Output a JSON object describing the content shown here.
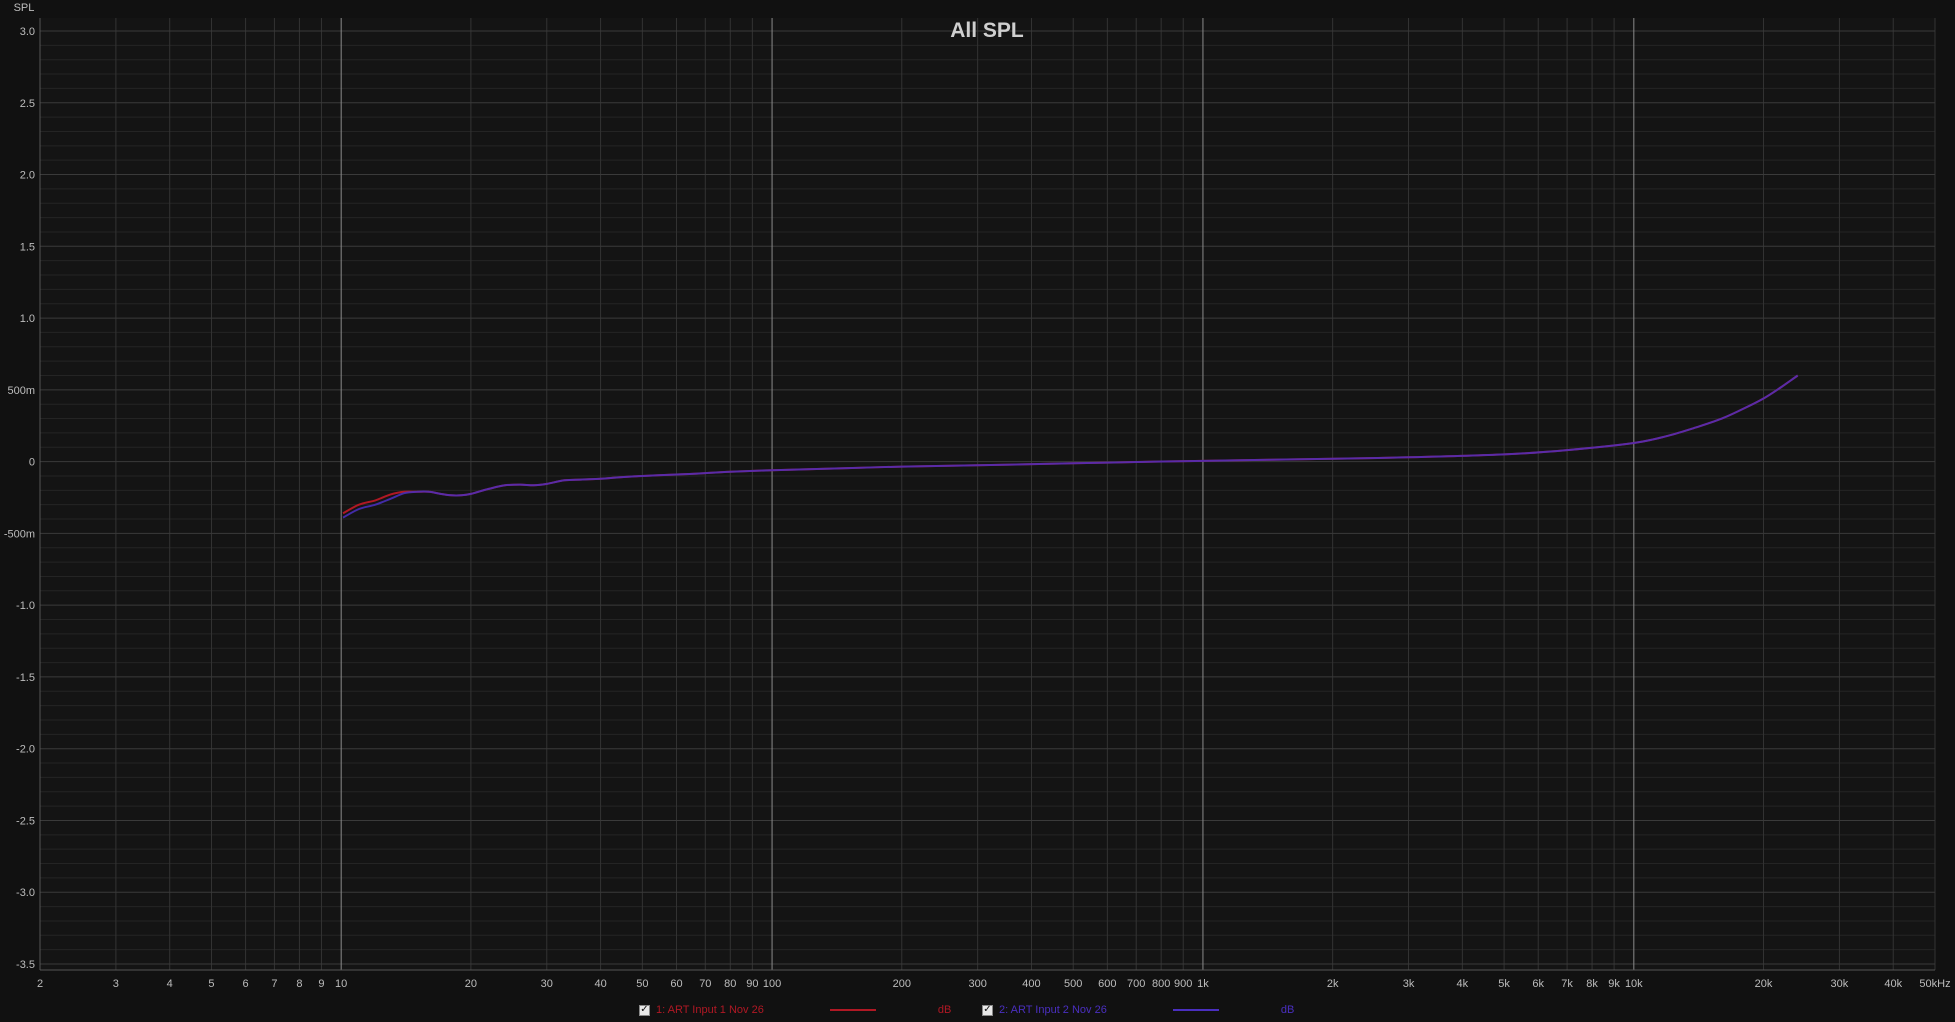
{
  "chart_data": {
    "type": "line",
    "title": "All SPL",
    "ylabel": "SPL",
    "xlabel": "",
    "xscale": "log",
    "xlim": [
      2,
      50000
    ],
    "ylim": [
      -3.5,
      3.0
    ],
    "grid": true,
    "x_tick_labels": [
      "2",
      "3",
      "4",
      "5",
      "6",
      "7",
      "8",
      "9",
      "10",
      "20",
      "30",
      "40",
      "50",
      "60",
      "70",
      "80",
      "90",
      "100",
      "200",
      "300",
      "400",
      "500",
      "600",
      "700",
      "800",
      "900",
      "1k",
      "2k",
      "3k",
      "4k",
      "5k",
      "6k",
      "7k",
      "8k",
      "9k",
      "10k",
      "20k",
      "30k",
      "40k",
      "50kHz"
    ],
    "y_tick_labels": [
      "3.0",
      "2.5",
      "2.0",
      "1.5",
      "1.0",
      "500m",
      "0",
      "-500m",
      "-1.0",
      "-1.5",
      "-2.0",
      "-2.5",
      "-3.0",
      "-3.5"
    ],
    "series": [
      {
        "name": "1: ART Input 1 Nov 26",
        "color": "#b01824",
        "unit": "dB",
        "x": [
          10.1,
          11,
          12,
          13,
          14,
          15,
          16,
          17,
          18,
          19,
          20,
          22,
          24,
          26,
          28,
          30,
          33,
          36,
          40,
          44,
          50,
          60,
          70,
          80,
          100,
          150,
          200,
          300,
          500,
          700,
          1000,
          2000,
          3000,
          5000,
          7000,
          10000,
          12000,
          14000,
          16000,
          18000,
          20000,
          22000,
          24000
        ],
        "values": [
          -0.36,
          -0.3,
          -0.27,
          -0.23,
          -0.21,
          -0.21,
          -0.21,
          -0.225,
          -0.235,
          -0.235,
          -0.225,
          -0.19,
          -0.165,
          -0.16,
          -0.165,
          -0.155,
          -0.13,
          -0.125,
          -0.12,
          -0.11,
          -0.1,
          -0.09,
          -0.08,
          -0.07,
          -0.06,
          -0.045,
          -0.035,
          -0.025,
          -0.012,
          -0.003,
          0.005,
          0.02,
          0.03,
          0.05,
          0.08,
          0.13,
          0.18,
          0.24,
          0.3,
          0.37,
          0.44,
          0.52,
          0.6
        ]
      },
      {
        "name": "2: ART Input 2 Nov 26",
        "color": "#4a2fc0",
        "unit": "dB",
        "x": [
          10.1,
          11,
          12,
          13,
          14,
          15,
          16,
          17,
          18,
          19,
          20,
          22,
          24,
          26,
          28,
          30,
          33,
          36,
          40,
          44,
          50,
          60,
          70,
          80,
          100,
          150,
          200,
          300,
          500,
          700,
          1000,
          2000,
          3000,
          5000,
          7000,
          10000,
          12000,
          14000,
          16000,
          18000,
          20000,
          22000,
          24000
        ],
        "values": [
          -0.39,
          -0.33,
          -0.3,
          -0.26,
          -0.22,
          -0.21,
          -0.21,
          -0.225,
          -0.235,
          -0.235,
          -0.225,
          -0.19,
          -0.165,
          -0.16,
          -0.165,
          -0.155,
          -0.13,
          -0.125,
          -0.12,
          -0.11,
          -0.1,
          -0.09,
          -0.08,
          -0.07,
          -0.06,
          -0.045,
          -0.035,
          -0.025,
          -0.012,
          -0.003,
          0.005,
          0.02,
          0.03,
          0.05,
          0.08,
          0.13,
          0.18,
          0.24,
          0.3,
          0.37,
          0.44,
          0.52,
          0.6
        ]
      }
    ]
  },
  "legend": [
    {
      "label": "1: ART Input 1 Nov 26",
      "unit": "dB",
      "color": "#b01824",
      "checked": true
    },
    {
      "label": "2: ART Input 2 Nov 26",
      "unit": "dB",
      "color": "#4a2fc0",
      "checked": true
    }
  ]
}
